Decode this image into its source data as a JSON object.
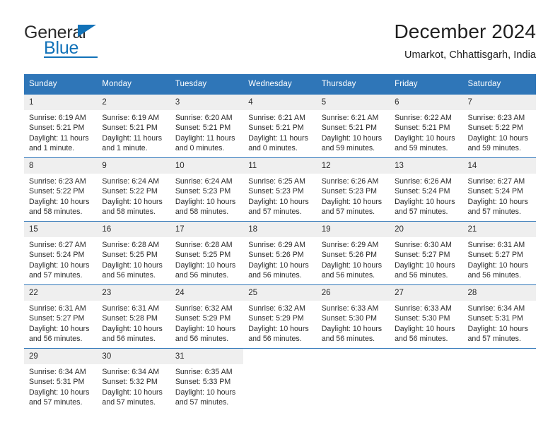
{
  "brand": {
    "name_part1": "General",
    "name_part2": "Blue",
    "triangle_icon": "triangle-icon",
    "accent_color": "#1272b8"
  },
  "header": {
    "title": "December 2024",
    "subtitle": "Umarkot, Chhattisgarh, India"
  },
  "calendar": {
    "header_color": "#2f76b8",
    "daynum_bg": "#efefef",
    "weekdays": [
      "Sunday",
      "Monday",
      "Tuesday",
      "Wednesday",
      "Thursday",
      "Friday",
      "Saturday"
    ],
    "weeks": [
      [
        {
          "day": "1",
          "sunrise": "Sunrise: 6:19 AM",
          "sunset": "Sunset: 5:21 PM",
          "daylight1": "Daylight: 11 hours",
          "daylight2": "and 1 minute."
        },
        {
          "day": "2",
          "sunrise": "Sunrise: 6:19 AM",
          "sunset": "Sunset: 5:21 PM",
          "daylight1": "Daylight: 11 hours",
          "daylight2": "and 1 minute."
        },
        {
          "day": "3",
          "sunrise": "Sunrise: 6:20 AM",
          "sunset": "Sunset: 5:21 PM",
          "daylight1": "Daylight: 11 hours",
          "daylight2": "and 0 minutes."
        },
        {
          "day": "4",
          "sunrise": "Sunrise: 6:21 AM",
          "sunset": "Sunset: 5:21 PM",
          "daylight1": "Daylight: 11 hours",
          "daylight2": "and 0 minutes."
        },
        {
          "day": "5",
          "sunrise": "Sunrise: 6:21 AM",
          "sunset": "Sunset: 5:21 PM",
          "daylight1": "Daylight: 10 hours",
          "daylight2": "and 59 minutes."
        },
        {
          "day": "6",
          "sunrise": "Sunrise: 6:22 AM",
          "sunset": "Sunset: 5:21 PM",
          "daylight1": "Daylight: 10 hours",
          "daylight2": "and 59 minutes."
        },
        {
          "day": "7",
          "sunrise": "Sunrise: 6:23 AM",
          "sunset": "Sunset: 5:22 PM",
          "daylight1": "Daylight: 10 hours",
          "daylight2": "and 59 minutes."
        }
      ],
      [
        {
          "day": "8",
          "sunrise": "Sunrise: 6:23 AM",
          "sunset": "Sunset: 5:22 PM",
          "daylight1": "Daylight: 10 hours",
          "daylight2": "and 58 minutes."
        },
        {
          "day": "9",
          "sunrise": "Sunrise: 6:24 AM",
          "sunset": "Sunset: 5:22 PM",
          "daylight1": "Daylight: 10 hours",
          "daylight2": "and 58 minutes."
        },
        {
          "day": "10",
          "sunrise": "Sunrise: 6:24 AM",
          "sunset": "Sunset: 5:23 PM",
          "daylight1": "Daylight: 10 hours",
          "daylight2": "and 58 minutes."
        },
        {
          "day": "11",
          "sunrise": "Sunrise: 6:25 AM",
          "sunset": "Sunset: 5:23 PM",
          "daylight1": "Daylight: 10 hours",
          "daylight2": "and 57 minutes."
        },
        {
          "day": "12",
          "sunrise": "Sunrise: 6:26 AM",
          "sunset": "Sunset: 5:23 PM",
          "daylight1": "Daylight: 10 hours",
          "daylight2": "and 57 minutes."
        },
        {
          "day": "13",
          "sunrise": "Sunrise: 6:26 AM",
          "sunset": "Sunset: 5:24 PM",
          "daylight1": "Daylight: 10 hours",
          "daylight2": "and 57 minutes."
        },
        {
          "day": "14",
          "sunrise": "Sunrise: 6:27 AM",
          "sunset": "Sunset: 5:24 PM",
          "daylight1": "Daylight: 10 hours",
          "daylight2": "and 57 minutes."
        }
      ],
      [
        {
          "day": "15",
          "sunrise": "Sunrise: 6:27 AM",
          "sunset": "Sunset: 5:24 PM",
          "daylight1": "Daylight: 10 hours",
          "daylight2": "and 57 minutes."
        },
        {
          "day": "16",
          "sunrise": "Sunrise: 6:28 AM",
          "sunset": "Sunset: 5:25 PM",
          "daylight1": "Daylight: 10 hours",
          "daylight2": "and 56 minutes."
        },
        {
          "day": "17",
          "sunrise": "Sunrise: 6:28 AM",
          "sunset": "Sunset: 5:25 PM",
          "daylight1": "Daylight: 10 hours",
          "daylight2": "and 56 minutes."
        },
        {
          "day": "18",
          "sunrise": "Sunrise: 6:29 AM",
          "sunset": "Sunset: 5:26 PM",
          "daylight1": "Daylight: 10 hours",
          "daylight2": "and 56 minutes."
        },
        {
          "day": "19",
          "sunrise": "Sunrise: 6:29 AM",
          "sunset": "Sunset: 5:26 PM",
          "daylight1": "Daylight: 10 hours",
          "daylight2": "and 56 minutes."
        },
        {
          "day": "20",
          "sunrise": "Sunrise: 6:30 AM",
          "sunset": "Sunset: 5:27 PM",
          "daylight1": "Daylight: 10 hours",
          "daylight2": "and 56 minutes."
        },
        {
          "day": "21",
          "sunrise": "Sunrise: 6:31 AM",
          "sunset": "Sunset: 5:27 PM",
          "daylight1": "Daylight: 10 hours",
          "daylight2": "and 56 minutes."
        }
      ],
      [
        {
          "day": "22",
          "sunrise": "Sunrise: 6:31 AM",
          "sunset": "Sunset: 5:27 PM",
          "daylight1": "Daylight: 10 hours",
          "daylight2": "and 56 minutes."
        },
        {
          "day": "23",
          "sunrise": "Sunrise: 6:31 AM",
          "sunset": "Sunset: 5:28 PM",
          "daylight1": "Daylight: 10 hours",
          "daylight2": "and 56 minutes."
        },
        {
          "day": "24",
          "sunrise": "Sunrise: 6:32 AM",
          "sunset": "Sunset: 5:29 PM",
          "daylight1": "Daylight: 10 hours",
          "daylight2": "and 56 minutes."
        },
        {
          "day": "25",
          "sunrise": "Sunrise: 6:32 AM",
          "sunset": "Sunset: 5:29 PM",
          "daylight1": "Daylight: 10 hours",
          "daylight2": "and 56 minutes."
        },
        {
          "day": "26",
          "sunrise": "Sunrise: 6:33 AM",
          "sunset": "Sunset: 5:30 PM",
          "daylight1": "Daylight: 10 hours",
          "daylight2": "and 56 minutes."
        },
        {
          "day": "27",
          "sunrise": "Sunrise: 6:33 AM",
          "sunset": "Sunset: 5:30 PM",
          "daylight1": "Daylight: 10 hours",
          "daylight2": "and 56 minutes."
        },
        {
          "day": "28",
          "sunrise": "Sunrise: 6:34 AM",
          "sunset": "Sunset: 5:31 PM",
          "daylight1": "Daylight: 10 hours",
          "daylight2": "and 57 minutes."
        }
      ],
      [
        {
          "day": "29",
          "sunrise": "Sunrise: 6:34 AM",
          "sunset": "Sunset: 5:31 PM",
          "daylight1": "Daylight: 10 hours",
          "daylight2": "and 57 minutes."
        },
        {
          "day": "30",
          "sunrise": "Sunrise: 6:34 AM",
          "sunset": "Sunset: 5:32 PM",
          "daylight1": "Daylight: 10 hours",
          "daylight2": "and 57 minutes."
        },
        {
          "day": "31",
          "sunrise": "Sunrise: 6:35 AM",
          "sunset": "Sunset: 5:33 PM",
          "daylight1": "Daylight: 10 hours",
          "daylight2": "and 57 minutes."
        },
        {
          "day": "",
          "sunrise": "",
          "sunset": "",
          "daylight1": "",
          "daylight2": ""
        },
        {
          "day": "",
          "sunrise": "",
          "sunset": "",
          "daylight1": "",
          "daylight2": ""
        },
        {
          "day": "",
          "sunrise": "",
          "sunset": "",
          "daylight1": "",
          "daylight2": ""
        },
        {
          "day": "",
          "sunrise": "",
          "sunset": "",
          "daylight1": "",
          "daylight2": ""
        }
      ]
    ]
  }
}
